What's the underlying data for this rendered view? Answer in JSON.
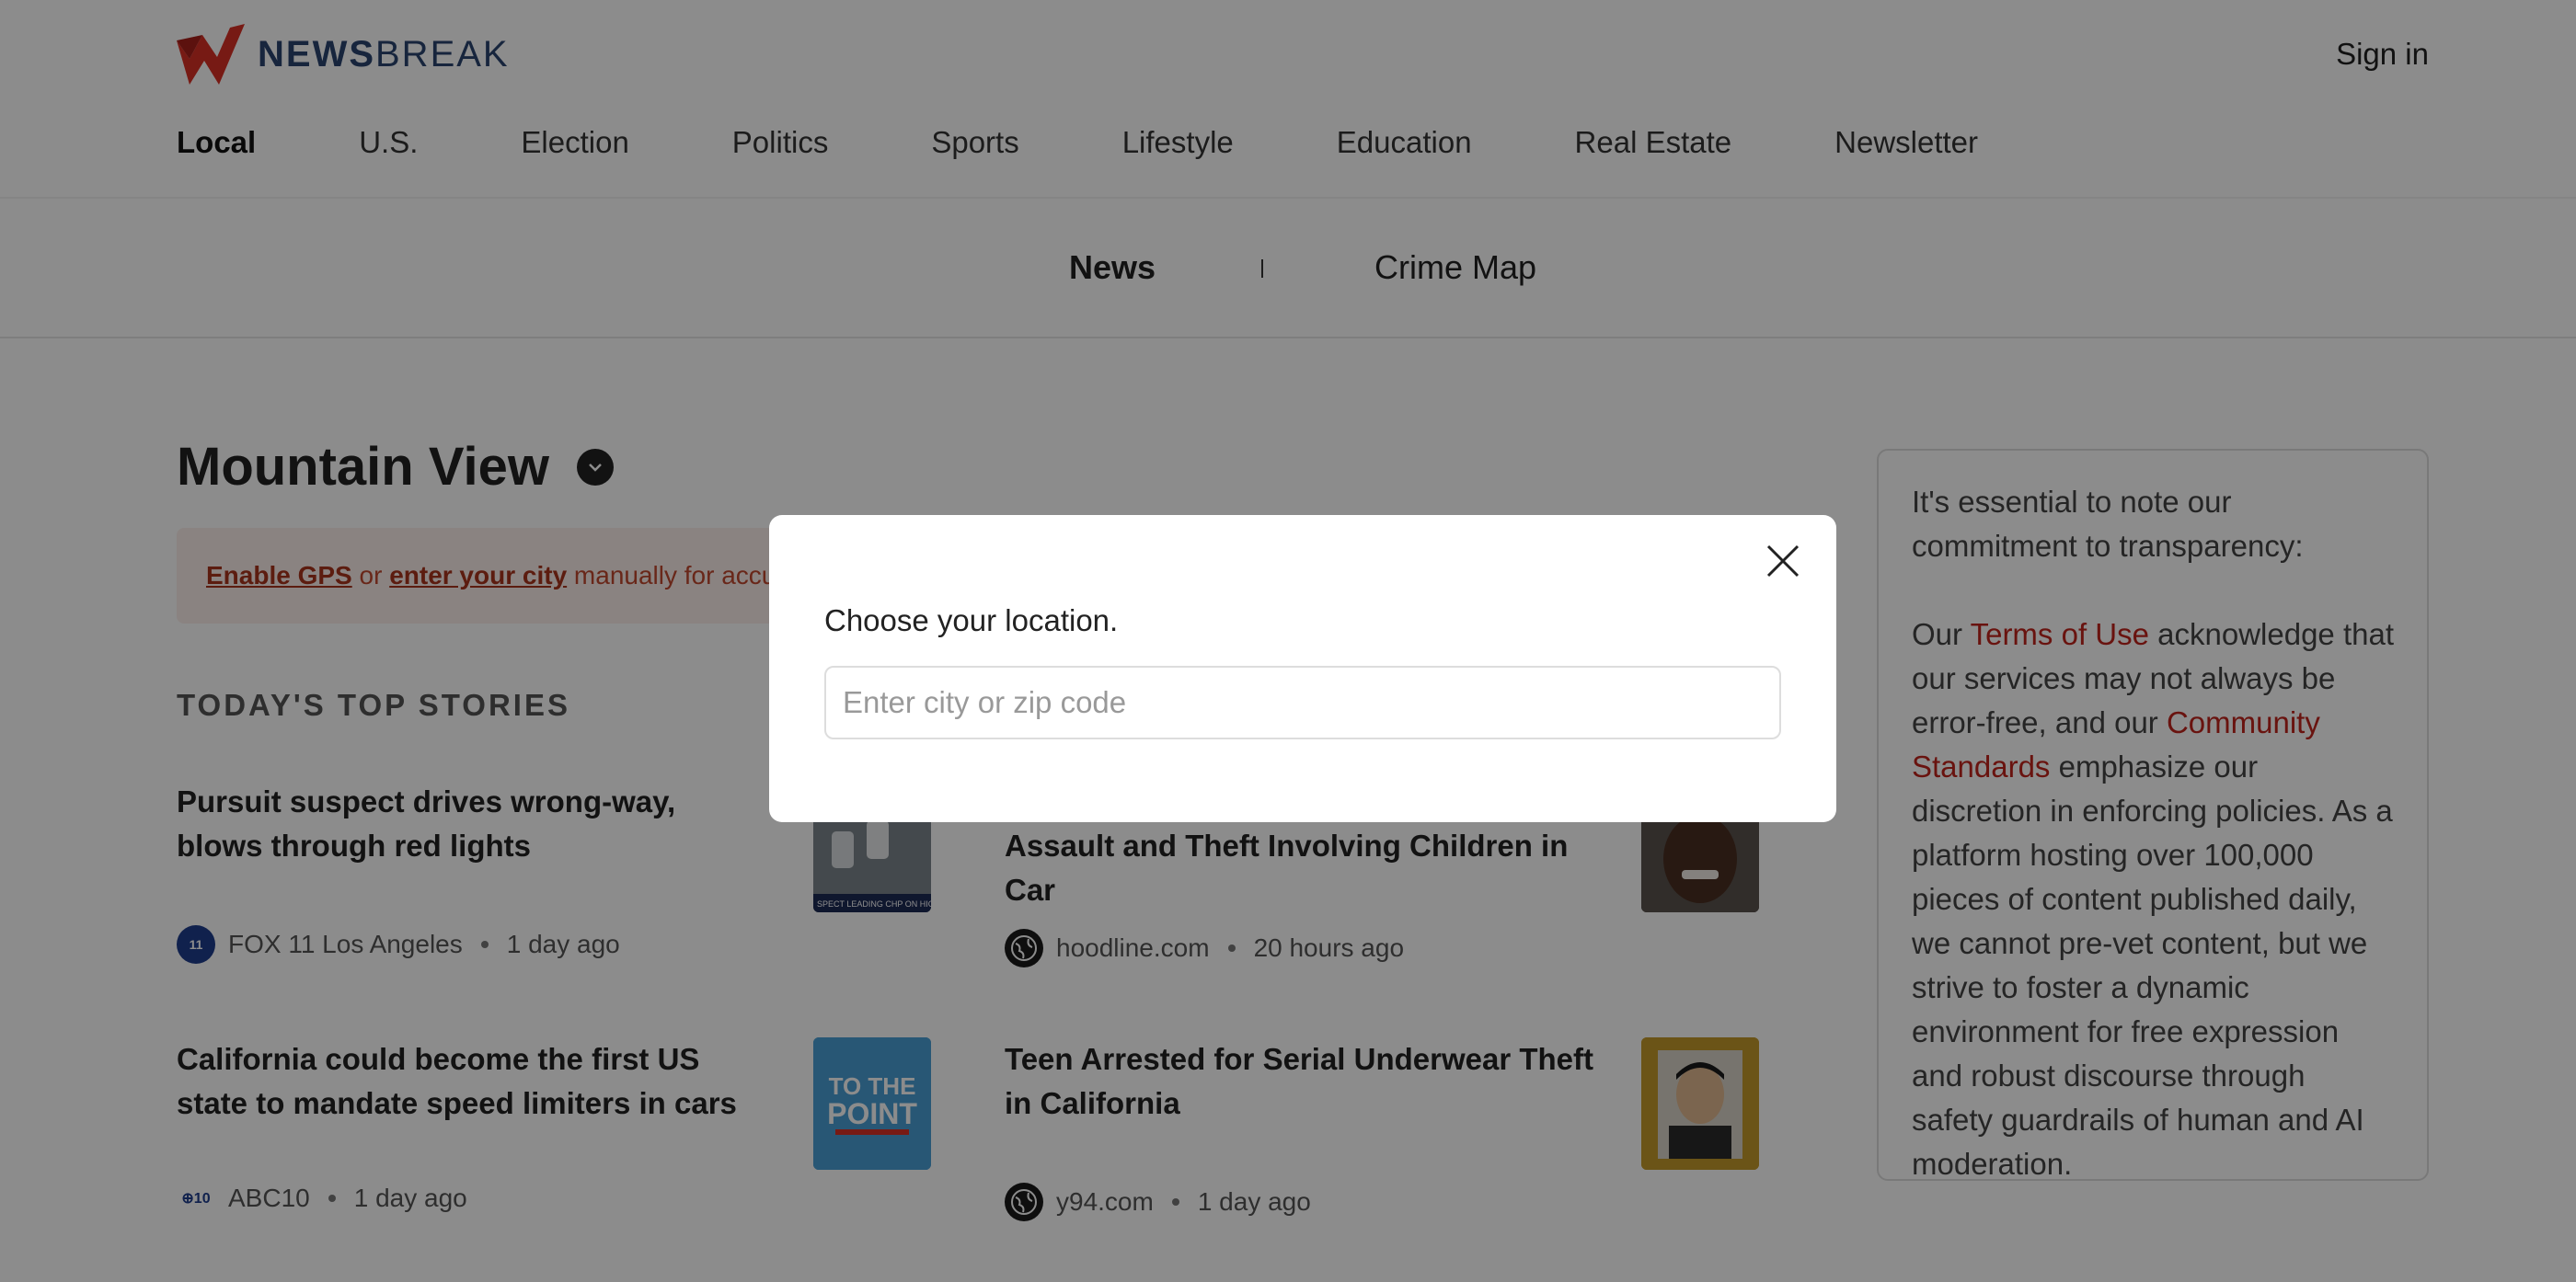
{
  "header": {
    "logo_bold": "NEWS",
    "logo_light": "BREAK",
    "sign_in": "Sign in"
  },
  "nav": {
    "items": [
      "Local",
      "U.S.",
      "Election",
      "Politics",
      "Sports",
      "Lifestyle",
      "Education",
      "Real Estate",
      "Newsletter"
    ],
    "active": "Local"
  },
  "subnav": {
    "news": "News",
    "crime_map": "Crime Map"
  },
  "main": {
    "city": "Mountain View",
    "gps_banner": {
      "enable_gps": "Enable GPS",
      "or": " or ",
      "enter_city": "enter your city",
      "rest": " manually for accura"
    },
    "section_title": "TODAY'S TOP STORIES",
    "stories": [
      {
        "title": "Pursuit suspect drives wrong-way, blows through red lights",
        "source": "FOX 11 Los Angeles",
        "time": "1 day ago",
        "icon": "fox11-logo-icon"
      },
      {
        "title": "Assault and Theft Involving Children in Car",
        "source": "hoodline.com",
        "time": "20 hours ago",
        "icon": "globe-icon"
      },
      {
        "title": "California could become the first US state to mandate speed limiters in cars",
        "source": "ABC10",
        "time": "1 day ago",
        "icon": "abc10-logo-icon"
      },
      {
        "title": "Teen Arrested for Serial Underwear Theft in California",
        "source": "y94.com",
        "time": "1 day ago",
        "icon": "globe-icon"
      }
    ],
    "thumb_texts": {
      "story1": "SPECT LEADING CHP ON HIGH-SP",
      "story3_line1": "TO THE",
      "story3_line2": "POINT"
    }
  },
  "sidebar": {
    "p1": "It's essential to note our commitment to transparency:",
    "p2_a": "Our ",
    "terms": "Terms of Use",
    "p2_b": " acknowledge that our services may not always be error-free, and our ",
    "community": "Community Standards",
    "p2_c": " emphasize our discretion in enforcing policies. As a platform hosting over 100,000 pieces of content published daily, we cannot pre-vet content, but we strive to foster a dynamic environment for free expression and robust discourse through safety guardrails of human and AI moderation."
  },
  "modal": {
    "prompt": "Choose your location.",
    "placeholder": "Enter city or zip code",
    "value": ""
  },
  "colors": {
    "brand_red": "#d93025",
    "link_red": "#c0241c",
    "overlay": "rgba(0,0,0,0.45)"
  }
}
